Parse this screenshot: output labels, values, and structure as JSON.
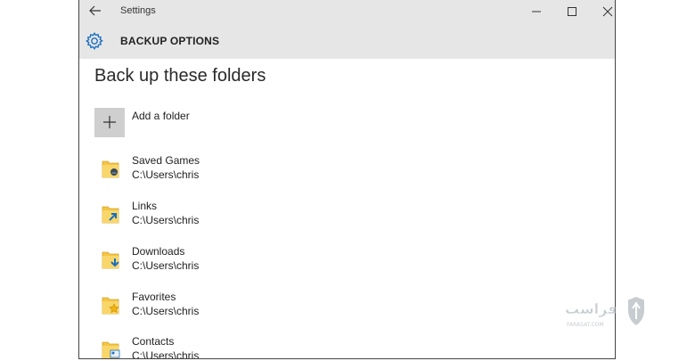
{
  "window": {
    "title": "Settings"
  },
  "header": {
    "title": "BACKUP OPTIONS"
  },
  "main": {
    "heading": "Back up these folders",
    "add_folder_label": "Add a folder",
    "folders": [
      {
        "name": "Saved Games",
        "path": "C:\\Users\\chris",
        "icon": "saved-games-folder-icon"
      },
      {
        "name": "Links",
        "path": "C:\\Users\\chris",
        "icon": "links-folder-icon"
      },
      {
        "name": "Downloads",
        "path": "C:\\Users\\chris",
        "icon": "downloads-folder-icon"
      },
      {
        "name": "Favorites",
        "path": "C:\\Users\\chris",
        "icon": "favorites-folder-icon"
      },
      {
        "name": "Contacts",
        "path": "C:\\Users\\chris",
        "icon": "contacts-folder-icon"
      }
    ]
  },
  "watermark": {
    "text": "فراست",
    "subtext": "FARASAT.COM"
  },
  "colors": {
    "titlebar_bg": "#e6e6e6",
    "accent": "#1a6fc0",
    "folder_yellow": "#f4c542",
    "add_button_bg": "#cfcfcf"
  }
}
